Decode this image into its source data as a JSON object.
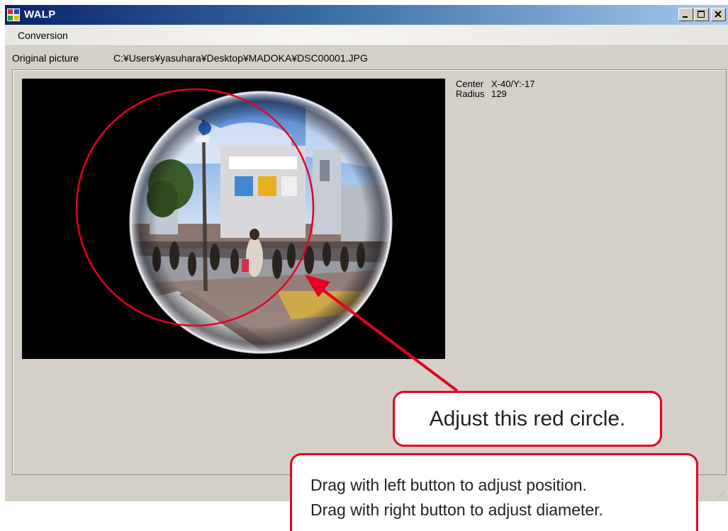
{
  "window": {
    "title": "WALP"
  },
  "menu": {
    "items": [
      {
        "label": "Conversion"
      }
    ]
  },
  "original_picture": {
    "label": "Original picture",
    "path": "C:¥Users¥yasuhara¥Desktop¥MADOKA¥DSC00001.JPG"
  },
  "info": {
    "center_label": "Center",
    "center_value": "X-40/Y:-17",
    "radius_label": "Radius",
    "radius_value": "129"
  },
  "callouts": {
    "main": "Adjust this red circle.",
    "line1": "Drag with left button to adjust position.",
    "line2": "Drag with right button to adjust diameter."
  },
  "colors": {
    "title_bar_start": "#0a246a",
    "title_bar_end": "#a6caf0",
    "window_bg": "#d4d0c8",
    "annotation_red": "#e60021",
    "picture_bg": "#000000"
  },
  "icons": {
    "app": "app-icon",
    "minimize": "minimize-icon",
    "maximize": "maximize-icon",
    "close": "close-icon",
    "resize": "resize-grip-icon"
  }
}
